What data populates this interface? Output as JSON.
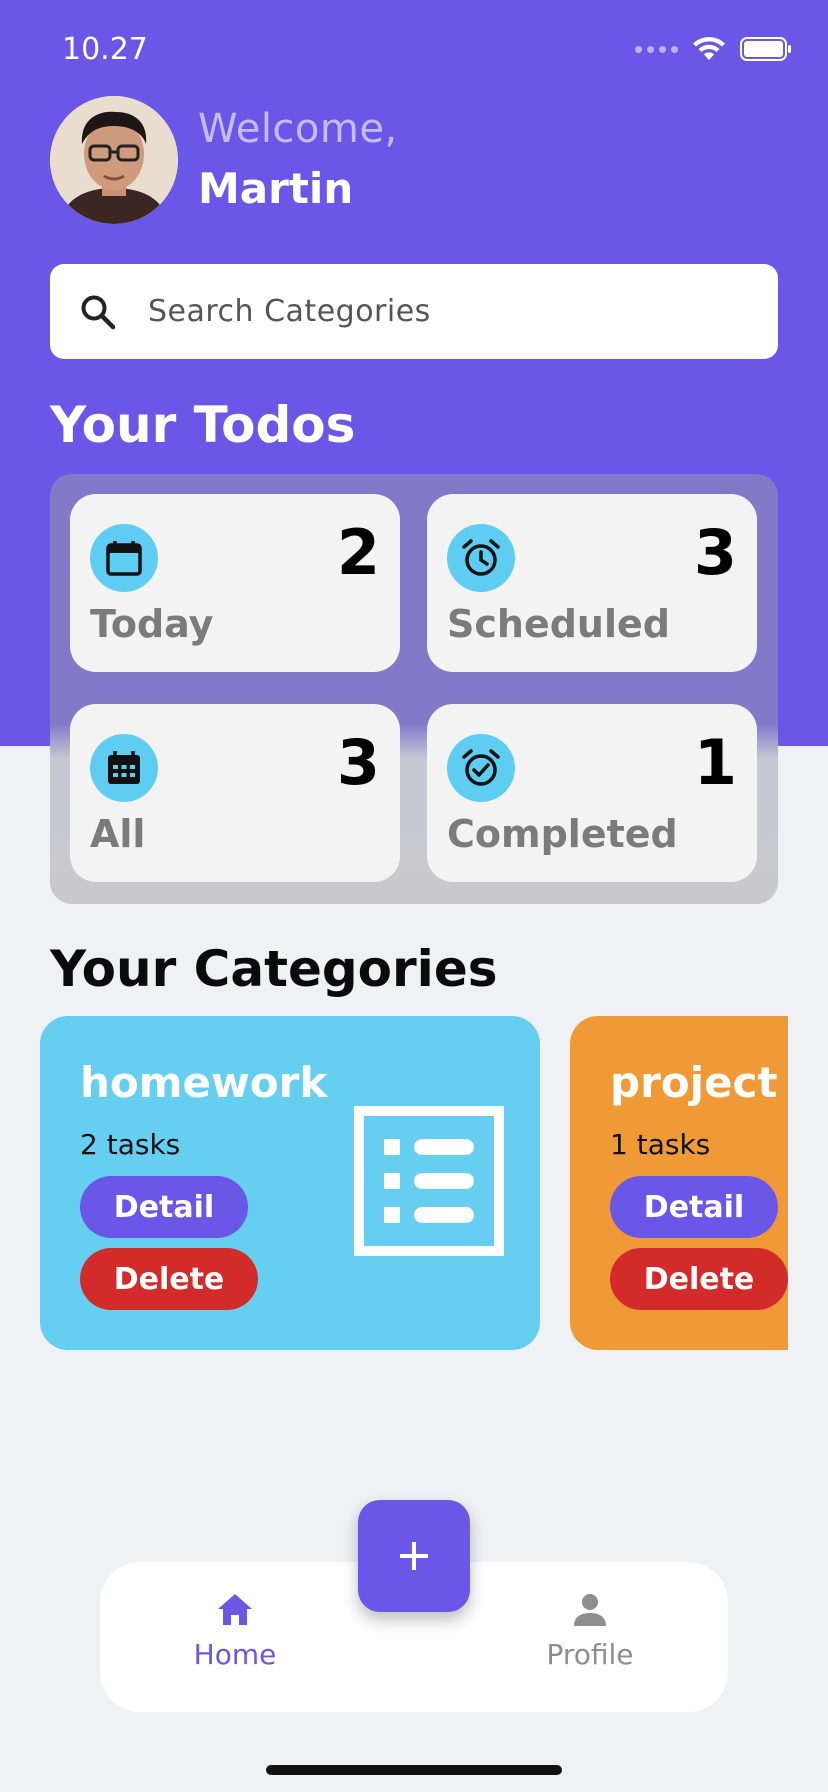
{
  "status_bar": {
    "time": "10.27"
  },
  "header": {
    "welcome": "Welcome,",
    "user_name": "Martin"
  },
  "search": {
    "placeholder": "Search Categories",
    "value": ""
  },
  "todos": {
    "title": "Your Todos",
    "cards": [
      {
        "label": "Today",
        "count": "2",
        "icon": "calendar-icon"
      },
      {
        "label": "Scheduled",
        "count": "3",
        "icon": "alarm-clock-icon"
      },
      {
        "label": "All",
        "count": "3",
        "icon": "calendar-grid-icon"
      },
      {
        "label": "Completed",
        "count": "1",
        "icon": "alarm-check-icon"
      }
    ]
  },
  "categories": {
    "title": "Your Categories",
    "items": [
      {
        "name": "homework",
        "tasks": "2 tasks",
        "detail_label": "Detail",
        "delete_label": "Delete",
        "color": "#66cef1",
        "icon": "list-icon"
      },
      {
        "name": "project",
        "tasks": "1 tasks",
        "detail_label": "Detail",
        "delete_label": "Delete",
        "color": "#f09a37",
        "icon": "list-icon"
      }
    ]
  },
  "nav": {
    "home_label": "Home",
    "profile_label": "Profile",
    "fab_label": "+"
  },
  "colors": {
    "primary": "#6a57e8",
    "accent_icon": "#5fcdf2",
    "delete": "#d32a2a",
    "homework": "#66cef1",
    "project": "#f09a37"
  }
}
